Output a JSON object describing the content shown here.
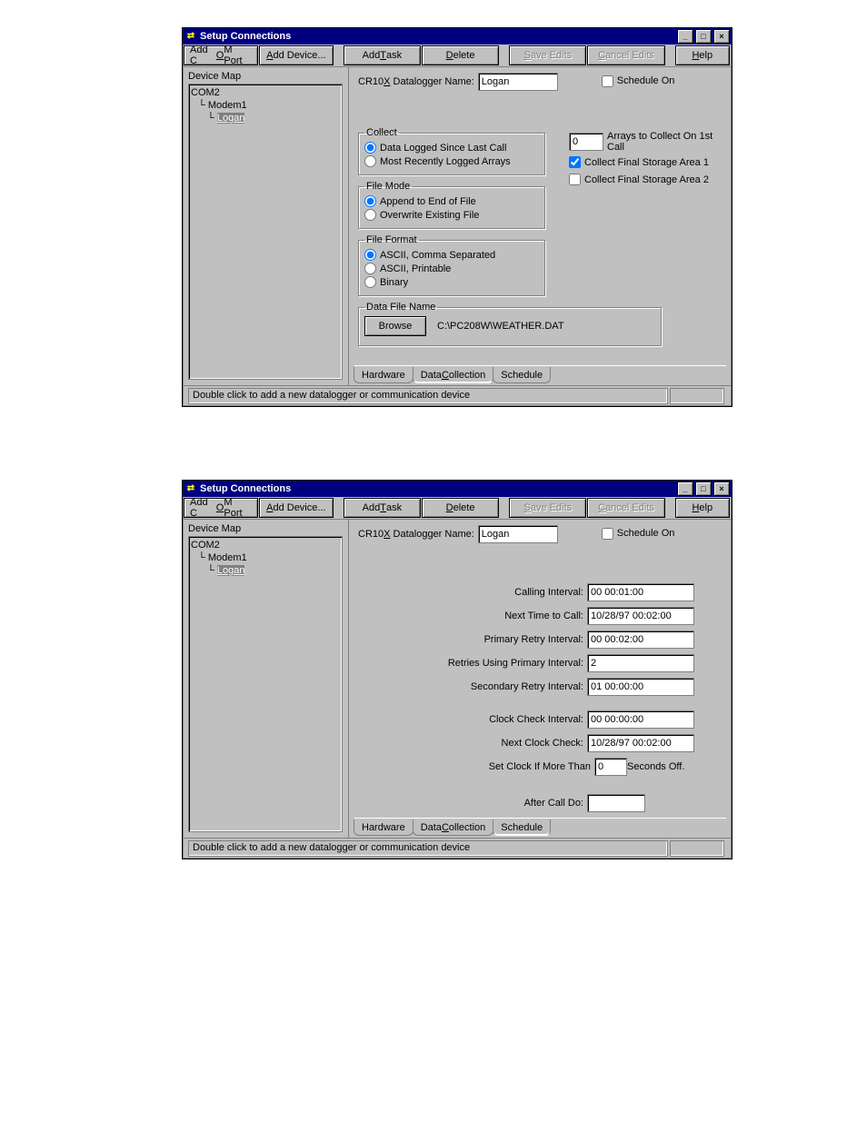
{
  "window_title": "Setup Connections",
  "toolbar": {
    "add_com": "Add COM Port",
    "add_com_u": "O",
    "add_device": "Add Device...",
    "add_device_u": "A",
    "add_task": "Add Task",
    "add_task_u": "T",
    "delete": "Delete",
    "delete_u": "D",
    "save": "Save Edits",
    "save_u": "S",
    "cancel": "Cancel Edits",
    "cancel_u": "C",
    "help": "Help",
    "help_u": "H"
  },
  "device_map_label": "Device Map",
  "tree": {
    "root": "COM2",
    "child1": "Modem1",
    "child2": "Logan"
  },
  "header": {
    "name_label": "CR10X Datalogger Name:",
    "name_label_u": "X",
    "name_value": "Logan",
    "schedule_on": "Schedule On",
    "schedule_on_checked": false
  },
  "collect": {
    "legend": "Collect",
    "opt1": "Data Logged Since Last Call",
    "opt2": "Most Recently Logged Arrays",
    "arrays_value": "0",
    "arrays_label": "Arrays to Collect On 1st Call",
    "cfs1": "Collect Final Storage Area 1",
    "cfs1_checked": true,
    "cfs2": "Collect Final Storage Area 2",
    "cfs2_checked": false
  },
  "filemode": {
    "legend": "File Mode",
    "opt1": "Append to End of File",
    "opt2": "Overwrite Existing File"
  },
  "fileformat": {
    "legend": "File Format",
    "opt1": "ASCII, Comma Separated",
    "opt2": "ASCII, Printable",
    "opt3": "Binary"
  },
  "datafile": {
    "legend": "Data File Name",
    "browse": "Browse",
    "path": "C:\\PC208W\\WEATHER.DAT"
  },
  "tabs": {
    "hardware": "Hardware",
    "datacol": "Data Collection",
    "datacol_u": "C",
    "schedule": "Schedule"
  },
  "status_text": "Double click to add a new datalogger or communication device",
  "sched": {
    "calling_int": "Calling Interval:",
    "calling_int_v": "00 00:01:00",
    "next_call": "Next Time to Call:",
    "next_call_v": "10/28/97 00:02:00",
    "primary_retry": "Primary Retry Interval:",
    "primary_retry_v": "00 00:02:00",
    "retries_using": "Retries Using Primary Interval:",
    "retries_using_v": "2",
    "secondary_retry": "Secondary Retry Interval:",
    "secondary_retry_v": "01 00:00:00",
    "clock_check": "Clock Check Interval:",
    "clock_check_v": "00 00:00:00",
    "next_clock": "Next Clock Check:",
    "next_clock_v": "10/28/97 00:02:00",
    "set_clock_pre": "Set Clock If More Than",
    "set_clock_v": "0",
    "set_clock_post": "Seconds Off.",
    "after_call": "After Call Do:",
    "after_call_v": ""
  }
}
